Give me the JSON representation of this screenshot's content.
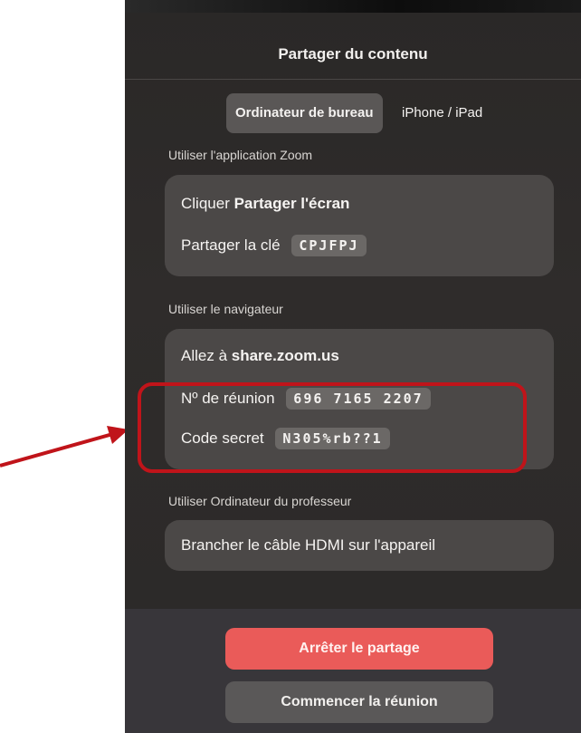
{
  "screen": {
    "title": "Partager du contenu"
  },
  "tabs": [
    {
      "label": "Ordinateur de bureau",
      "selected": true
    },
    {
      "label": "iPhone / iPad",
      "selected": false
    }
  ],
  "zoom_app": {
    "section_label": "Utiliser l'application Zoom",
    "click_prefix": "Cliquer",
    "click_action": "Partager l'écran",
    "key_label": "Partager la clé",
    "key_value": "CPJFPJ"
  },
  "browser": {
    "section_label": "Utiliser le navigateur",
    "goto_prefix": "Allez à",
    "goto_url": "share.zoom.us",
    "meeting_label": "Nº de réunion",
    "meeting_value": "696 7165 2207",
    "code_label": "Code secret",
    "code_value": "N305%rb??1"
  },
  "teacher": {
    "section_label": "Utiliser Ordinateur du professeur",
    "instruction": "Brancher le câble HDMI sur l'appareil"
  },
  "actions": {
    "stop_label": "Arrêter le partage",
    "start_label": "Commencer la réunion"
  },
  "colors": {
    "background": "#2f2c2b",
    "card": "#4b4847",
    "stop_button": "#ea5b59",
    "start_button": "#5a5858",
    "annotation": "#c0141a"
  }
}
